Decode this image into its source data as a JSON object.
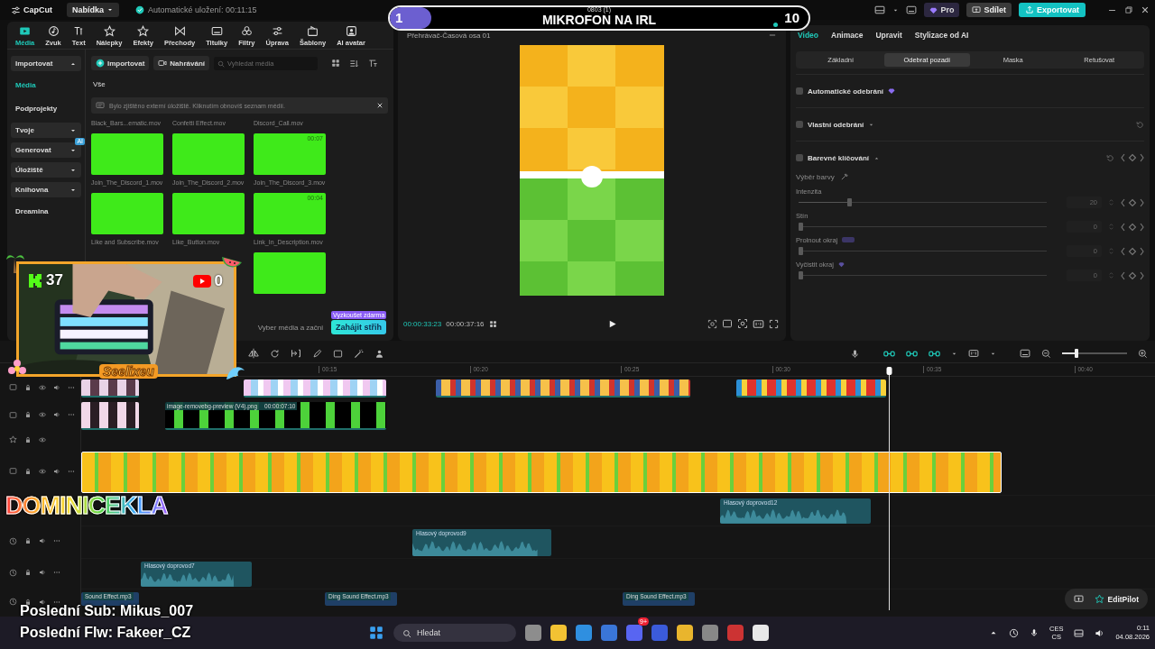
{
  "title_bar": {
    "app_name": "CapCut",
    "menu": "Nabídka",
    "autosave": "Automatické uložení: 00:11:15",
    "pro": "Pro",
    "share": "Sdílet",
    "export": "Exportovat"
  },
  "media_panel": {
    "tabs": [
      {
        "label": "Média",
        "selected": true
      },
      {
        "label": "Zvuk",
        "selected": false
      },
      {
        "label": "Text",
        "selected": false
      },
      {
        "label": "Nálepky",
        "selected": false
      },
      {
        "label": "Efekty",
        "selected": false
      },
      {
        "label": "Přechody",
        "selected": false
      },
      {
        "label": "Titulky",
        "selected": false
      },
      {
        "label": "Filtry",
        "selected": false
      },
      {
        "label": "Úprava",
        "selected": false
      },
      {
        "label": "Šablony",
        "selected": false
      },
      {
        "label": "AI avatar",
        "selected": false
      }
    ],
    "sidebar": [
      {
        "kind": "group",
        "label": "Importovat",
        "expanded": true
      },
      {
        "kind": "item",
        "label": "Média",
        "selected": true
      },
      {
        "kind": "item",
        "label": "Podprojekty",
        "selected": false
      },
      {
        "kind": "group",
        "label": "Tvoje",
        "expanded": false
      },
      {
        "kind": "group",
        "label": "Generovat",
        "expanded": false,
        "badge": "AI"
      },
      {
        "kind": "group",
        "label": "Úložiště",
        "expanded": false
      },
      {
        "kind": "group",
        "label": "Knihovna",
        "expanded": false
      },
      {
        "kind": "item",
        "label": "Dreamina",
        "selected": false
      }
    ],
    "import_button": "Importovat",
    "record_button": "Nahrávání",
    "search": {
      "placeholder": "Vyhledat média"
    },
    "filter": "Vše",
    "notice": "Bylo zjištěno externí úložiště. Kliknutím obnovíš seznam médií.",
    "rows": [
      [
        {
          "kind": "name_only",
          "name": "Black_Bars...ematic.mov"
        },
        {
          "kind": "name_only",
          "name": "Confetti Effect.mov"
        },
        {
          "kind": "name_only",
          "name": "Discord_Call.mov"
        }
      ],
      [
        {
          "kind": "clip",
          "name": "Join_The_Discord_1.mov"
        },
        {
          "kind": "clip",
          "name": "Join_The_Discord_2.mov"
        },
        {
          "kind": "clip",
          "name": "Join_The_Discord_3.mov",
          "duration": "00:07"
        }
      ],
      [
        {
          "kind": "clip",
          "name": "Like and Subscribe.mov"
        },
        {
          "kind": "clip",
          "name": "Like_Button.mov"
        },
        {
          "kind": "clip",
          "name": "Link_In_Description.mov",
          "duration": "00:04"
        }
      ],
      [
        {
          "kind": "thumb_only"
        }
      ]
    ],
    "start_prompt": "Vyber média a začni",
    "start_button": "Zahájit střih",
    "start_badge": "Vyzkoušet zdarma"
  },
  "preview": {
    "title": "Přehrávač-Časová osa 01",
    "current_time": "00:00:33:23",
    "total_time": "00:00:37:16"
  },
  "properties": {
    "tabs": [
      {
        "label": "Video",
        "selected": true
      },
      {
        "label": "Animace",
        "selected": false
      },
      {
        "label": "Upravit",
        "selected": false
      },
      {
        "label": "Stylizace od AI",
        "selected": false
      }
    ],
    "subtabs": [
      {
        "label": "Základní",
        "selected": false
      },
      {
        "label": "Odebrat pozadí",
        "selected": true
      },
      {
        "label": "Maska",
        "selected": false
      },
      {
        "label": "Retušovat",
        "selected": false
      }
    ],
    "options": [
      {
        "label": "Automatické odebrání",
        "checked": false,
        "premium": true
      },
      {
        "label": "Vlastní odebrání",
        "checked": false,
        "expanded": false
      },
      {
        "label": "Barevné klíčování",
        "checked": false,
        "expanded": true
      }
    ],
    "color_picker": "Výběr barvy",
    "sliders": [
      {
        "label": "Intenzita",
        "level": 0.2,
        "value": "20"
      },
      {
        "label": "Stín",
        "level": 0,
        "value": "0"
      },
      {
        "label": "Prolnout okraj",
        "level": 0,
        "value": "0",
        "badge": true
      },
      {
        "label": "Vyčistit okraj",
        "level": 0,
        "value": "0",
        "premium": true
      }
    ]
  },
  "timeline": {
    "ruler": [
      "00:15",
      "00:20",
      "00:25",
      "00:30",
      "00:35",
      "00:40"
    ],
    "zoom": {
      "level": 0.2
    },
    "tracks": [
      {
        "kind": "video",
        "clips": [
          {
            "kind": "video",
            "selected": false
          },
          {
            "kind": "video",
            "selected": false
          },
          {
            "kind": "video",
            "selected": false
          },
          {
            "kind": "video",
            "selected": false
          }
        ]
      },
      {
        "kind": "video",
        "clips": [
          {
            "kind": "video",
            "selected": false
          },
          {
            "kind": "video",
            "selected": false,
            "label": "image-removebg-preview (V4).png",
            "duration": "00:00:07:10"
          }
        ]
      },
      {
        "kind": "effect"
      },
      {
        "kind": "video",
        "clips": [
          {
            "kind": "video",
            "selected": true
          }
        ]
      },
      {
        "kind": "audio",
        "clips": [
          {
            "kind": "audio",
            "selected": false,
            "label": "Hlasový doprovod12"
          }
        ]
      },
      {
        "kind": "audio",
        "clips": [
          {
            "kind": "audio",
            "selected": false,
            "label": "Hlasový doprovod9"
          }
        ]
      },
      {
        "kind": "audio",
        "clips": [
          {
            "kind": "audio",
            "selected": false,
            "label": "Hlasový doprovod7"
          }
        ]
      },
      {
        "kind": "audio",
        "clips": [
          {
            "kind": "sound",
            "selected": false,
            "label": "Sound Effect.mp3"
          },
          {
            "kind": "sound",
            "selected": false,
            "label": "Ding Sound Effect.mp3"
          },
          {
            "kind": "sound",
            "selected": false,
            "label": "Ding Sound Effect.mp3"
          }
        ]
      }
    ],
    "assistant_button": "EditPilot"
  },
  "taskbar": {
    "search": {
      "placeholder": "Hledat"
    },
    "notification_badge": "9+",
    "language": "CES",
    "layout": "CS",
    "time": "0:11",
    "date": "04.08.2026"
  },
  "stream_overlay": {
    "goal": {
      "current": "1",
      "subtitle": "0803 (1)",
      "title": "MIKROFON NA IRL",
      "target": "10",
      "level": 0.1
    },
    "webcam": {
      "kind": "picture",
      "kick_count": "37",
      "youtube_count": "0",
      "name": "Seelixeu"
    },
    "channel_name": "DOMINICEKLA",
    "last_sub": "Poslední Sub: Mikus_007",
    "last_follow": "Poslední Flw: Fakeer_CZ"
  }
}
